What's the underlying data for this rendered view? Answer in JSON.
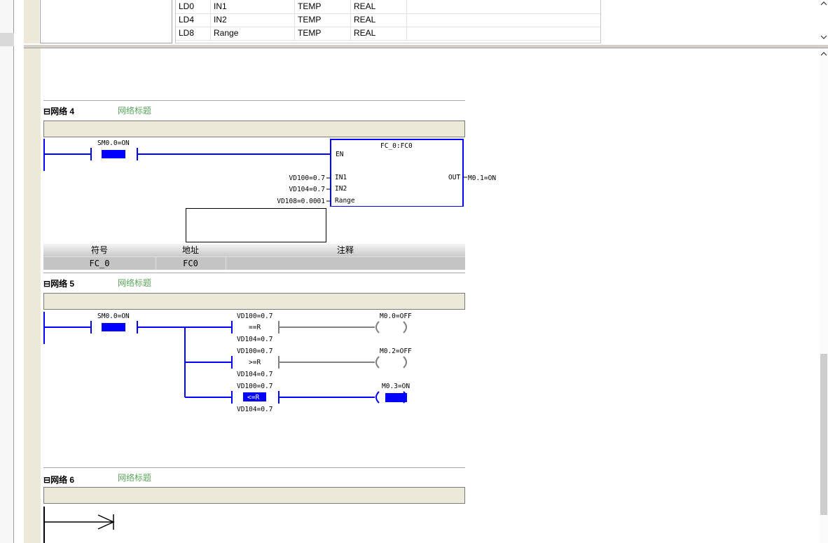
{
  "var_table": {
    "rows": [
      {
        "address": "LD0",
        "name": "IN1",
        "var_type": "TEMP",
        "data_type": "REAL"
      },
      {
        "address": "LD4",
        "name": "IN2",
        "var_type": "TEMP",
        "data_type": "REAL"
      },
      {
        "address": "LD8",
        "name": "Range",
        "var_type": "TEMP",
        "data_type": "REAL"
      }
    ]
  },
  "networks": [
    {
      "label": "网络 4",
      "title": "网络标题",
      "contact": "SM0.0=ON",
      "block": {
        "name": "FC_0:FC0",
        "en": "EN",
        "inputs": [
          {
            "pin": "IN1",
            "value": "VD100=0.7"
          },
          {
            "pin": "IN2",
            "value": "VD104=0.7"
          },
          {
            "pin": "Range",
            "value": "VD108=0.0001"
          }
        ],
        "output": {
          "pin": "OUT",
          "value": "M0.1=ON"
        }
      },
      "symbol_table": {
        "headers": [
          "符号",
          "地址",
          "注释"
        ],
        "row": [
          "FC_0",
          "FC0",
          ""
        ]
      }
    },
    {
      "label": "网络 5",
      "title": "网络标题",
      "contact": "SM0.0=ON",
      "branches": [
        {
          "top": "VD100=0.7",
          "op": "==R",
          "bottom": "VD104=0.7",
          "coil": "M0.0=OFF",
          "active": false
        },
        {
          "top": "VD100=0.7",
          "op": ">=R",
          "bottom": "VD104=0.7",
          "coil": "M0.2=OFF",
          "active": false
        },
        {
          "top": "VD100=0.7",
          "op": "<=R",
          "bottom": "VD104=0.7",
          "coil": "M0.3=ON",
          "active": true
        }
      ]
    },
    {
      "label": "网络 6",
      "title": "网络标题"
    }
  ],
  "colors": {
    "power_flow": "#0000ff",
    "inactive": "#808080",
    "title_green": "#5aa55a",
    "comment_bg": "#ece9d8"
  }
}
